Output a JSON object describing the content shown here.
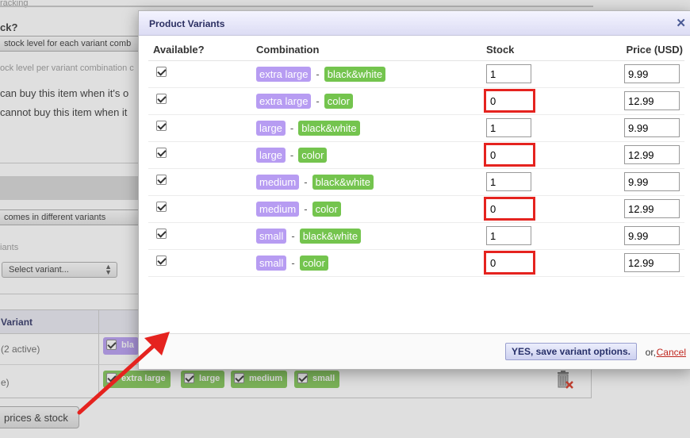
{
  "background": {
    "tracking_label": "racking",
    "stock_heading": "ck?",
    "stock_option_each": "stock level for each variant comb",
    "stock_option_hint": "ock level per variant combination c",
    "can_buy_text": "can buy this item when it's o",
    "cannot_buy_text": "cannot buy this item when it",
    "variants_option": "comes in different variants",
    "variants_label": "iants",
    "select_variant_placeholder": "Select variant...",
    "table_header": "Variant",
    "row1_label": "(2 active)",
    "row1_chip": "bla",
    "row2_label": "e)",
    "size_chips": [
      "extra large",
      "large",
      "medium",
      "small"
    ],
    "prices_button": "prices & stock"
  },
  "modal": {
    "title": "Product Variants",
    "columns": {
      "available": "Available?",
      "combination": "Combination",
      "stock": "Stock",
      "price": "Price (USD)"
    },
    "rows": [
      {
        "available": true,
        "size": "extra large",
        "color": "black&white",
        "stock": "1",
        "price": "9.99",
        "highlighted": false
      },
      {
        "available": true,
        "size": "extra large",
        "color": "color",
        "stock": "0",
        "price": "12.99",
        "highlighted": true
      },
      {
        "available": true,
        "size": "large",
        "color": "black&white",
        "stock": "1",
        "price": "9.99",
        "highlighted": false
      },
      {
        "available": true,
        "size": "large",
        "color": "color",
        "stock": "0",
        "price": "12.99",
        "highlighted": true
      },
      {
        "available": true,
        "size": "medium",
        "color": "black&white",
        "stock": "1",
        "price": "9.99",
        "highlighted": false
      },
      {
        "available": true,
        "size": "medium",
        "color": "color",
        "stock": "0",
        "price": "12.99",
        "highlighted": true
      },
      {
        "available": true,
        "size": "small",
        "color": "black&white",
        "stock": "1",
        "price": "9.99",
        "highlighted": false
      },
      {
        "available": true,
        "size": "small",
        "color": "color",
        "stock": "0",
        "price": "12.99",
        "highlighted": true
      }
    ],
    "combo_separator": "-",
    "save_button": "YES, save variant options.",
    "or_text": "or,",
    "cancel_link": "Cancel"
  },
  "colors": {
    "size_tag": "#b79cf2",
    "color_tag": "#74c44e",
    "highlight": "#e5231f",
    "arrow": "#e5231f"
  }
}
